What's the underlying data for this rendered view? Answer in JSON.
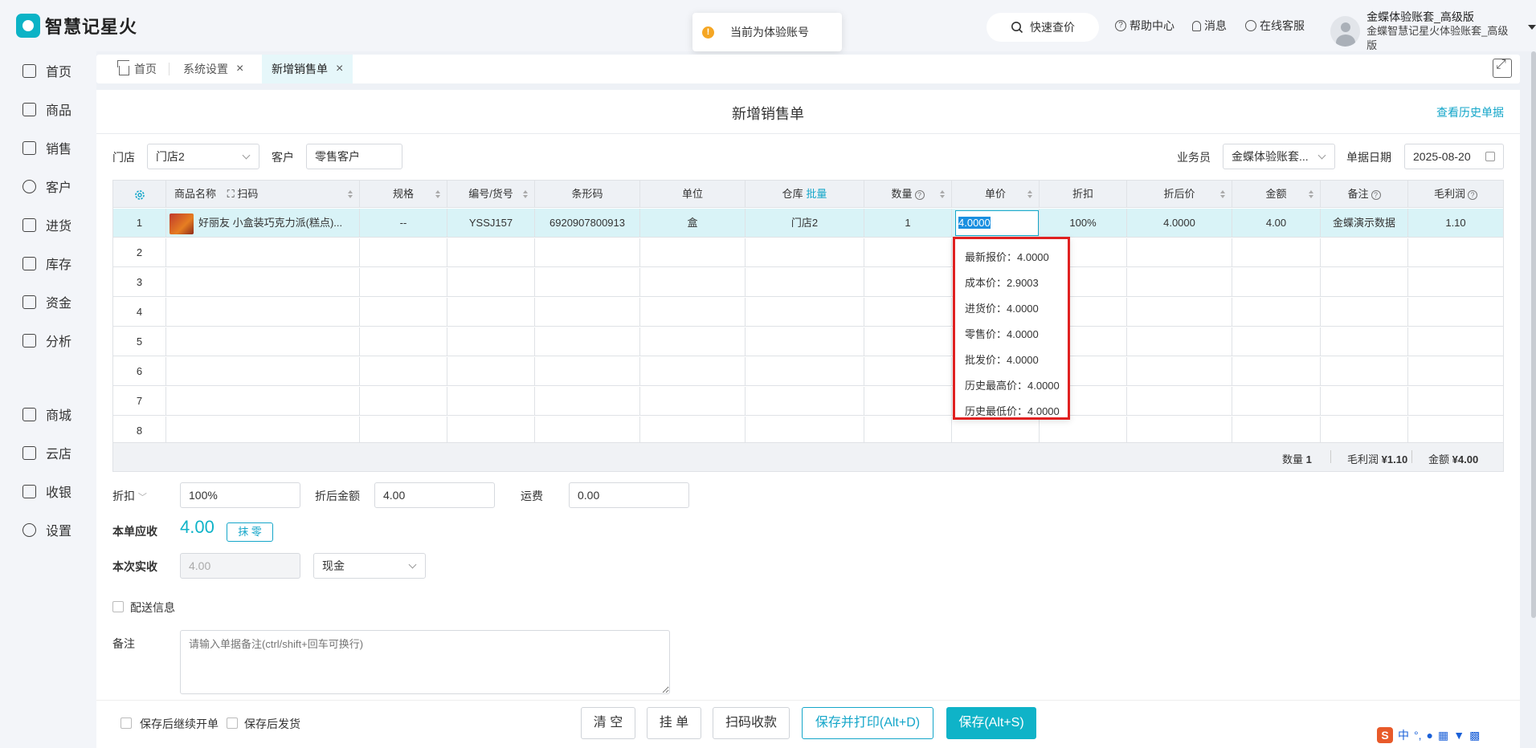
{
  "app": {
    "name": "智慧记星火"
  },
  "toast": {
    "text": "当前为体验账号"
  },
  "header": {
    "quick_search": "快速查价",
    "help": "帮助中心",
    "messages": "消息",
    "service": "在线客服",
    "user_name": "金蝶体验账套_高级版",
    "user_sub": "金蝶智慧记星火体验账套_高级版"
  },
  "sidebar": {
    "items": [
      {
        "label": "首页",
        "icon": "home-icon"
      },
      {
        "label": "商品",
        "icon": "bag-icon"
      },
      {
        "label": "销售",
        "icon": "receipt-icon"
      },
      {
        "label": "客户",
        "icon": "person-icon"
      },
      {
        "label": "进货",
        "icon": "book-icon"
      },
      {
        "label": "库存",
        "icon": "warehouse-icon"
      },
      {
        "label": "资金",
        "icon": "wallet-icon"
      },
      {
        "label": "分析",
        "icon": "chart-icon"
      },
      {
        "label": "商城",
        "icon": "shop-icon"
      },
      {
        "label": "云店",
        "icon": "cloud-store-icon"
      },
      {
        "label": "收银",
        "icon": "cashier-icon"
      },
      {
        "label": "设置",
        "icon": "gear-icon"
      }
    ]
  },
  "tabs": [
    {
      "label": "首页"
    },
    {
      "label": "系统设置"
    },
    {
      "label": "新增销售单"
    }
  ],
  "page": {
    "title": "新增销售单",
    "history_link": "查看历史单据"
  },
  "form": {
    "store_label": "门店",
    "store_value": "门店2",
    "customer_label": "客户",
    "customer_value": "零售客户",
    "salesperson_label": "业务员",
    "salesperson_value": "金蝶体验账套...",
    "date_label": "单据日期",
    "date_value": "2025-08-20"
  },
  "grid": {
    "headers": {
      "name": "商品名称",
      "scan": "扫码",
      "spec": "规格",
      "code": "编号/货号",
      "barcode": "条形码",
      "unit": "单位",
      "warehouse": "仓库",
      "batch": "批量",
      "qty": "数量",
      "price": "单价",
      "discount": "折扣",
      "after_price": "折后价",
      "amount": "金额",
      "remark": "备注",
      "profit": "毛利润"
    },
    "row1": {
      "no": "1",
      "name": "好丽友 小盒装巧克力派(糕点)...",
      "spec": "--",
      "code": "YSSJ157",
      "barcode": "6920907800913",
      "unit": "盒",
      "warehouse": "门店2",
      "qty": "1",
      "price": "4.0000",
      "discount": "100%",
      "after_price": "4.0000",
      "amount": "4.00",
      "remark": "金蝶演示数据",
      "profit": "1.10"
    },
    "empty_rows": [
      "2",
      "3",
      "4",
      "5",
      "6",
      "7",
      "8"
    ],
    "footer": {
      "qty_label": "数量",
      "qty_value": "1",
      "profit_label": "毛利润",
      "profit_value": "¥1.10",
      "amount_label": "金额",
      "amount_value": "¥4.00"
    }
  },
  "price_popup": {
    "items": [
      "最新报价：4.0000",
      "成本价：2.9003",
      "进货价：4.0000",
      "零售价：4.0000",
      "批发价：4.0000",
      "历史最高价：4.0000",
      "历史最低价：4.0000"
    ]
  },
  "totals": {
    "discount_label": "折扣",
    "discount_value": "100%",
    "after_amount_label": "折后金额",
    "after_amount_value": "4.00",
    "freight_label": "运费",
    "freight_value": "0.00",
    "receivable_label": "本单应收",
    "receivable_value": "4.00",
    "round_button": "抹 零",
    "received_label": "本次实收",
    "received_value": "4.00",
    "payment_method": "现金",
    "delivery_label": "配送信息",
    "remark_label": "备注",
    "remark_placeholder": "请输入单据备注(ctrl/shift+回车可换行)"
  },
  "footer_bar": {
    "continue_label": "保存后继续开单",
    "ship_label": "保存后发货",
    "clear": "清 空",
    "hold": "挂 单",
    "scan_pay": "扫码收款",
    "save_print": "保存并打印(Alt+D)",
    "save": "保存(Alt+S)"
  },
  "ime": {
    "lang": "中"
  }
}
